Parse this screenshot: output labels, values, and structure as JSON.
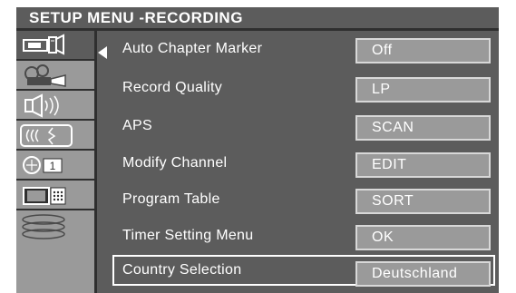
{
  "menu": {
    "title": "SETUP MENU -RECORDING",
    "items": [
      {
        "label": "Auto Chapter Marker",
        "value": "Off"
      },
      {
        "label": "Record Quality",
        "value": "LP"
      },
      {
        "label": "APS",
        "value": "SCAN"
      },
      {
        "label": "Modify Channel",
        "value": "EDIT"
      },
      {
        "label": "Program Table",
        "value": "SORT"
      },
      {
        "label": "Timer Setting Menu",
        "value": "OK"
      },
      {
        "label": "Country Selection",
        "value": "Deutschland"
      }
    ],
    "selected_item": "Country Selection"
  },
  "sidebar": {
    "icons": [
      {
        "name": "recorder-camera-icon",
        "active": true
      },
      {
        "name": "projector-film-icon",
        "active": false
      },
      {
        "name": "speaker-audio-icon",
        "active": false
      },
      {
        "name": "radio-signal-icon",
        "active": false
      },
      {
        "name": "channel-number-icon",
        "active": false
      },
      {
        "name": "tv-monitor-icon",
        "active": false
      },
      {
        "name": "disc-stack-icon",
        "active": false
      }
    ],
    "channel_number": "1"
  },
  "colors": {
    "panel": "#5c5c5c",
    "sidebar": "#9a9a9a",
    "divider": "#2f2f2f",
    "text": "#ffffff"
  }
}
